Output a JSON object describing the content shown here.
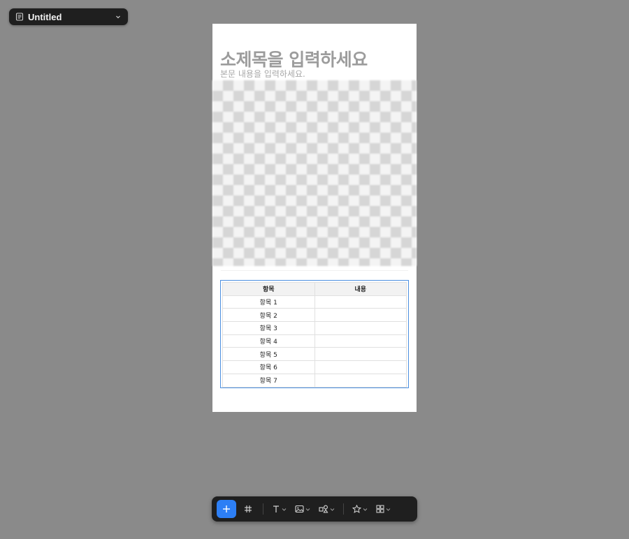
{
  "file_menu": {
    "name": "Untitled"
  },
  "page": {
    "heading": "소제목을 입력하세요",
    "body": "본문 내용을 입력하세요."
  },
  "table": {
    "headers": [
      "항목",
      "내용"
    ],
    "rows": [
      [
        "항목 1",
        ""
      ],
      [
        "항목 2",
        ""
      ],
      [
        "항목 3",
        ""
      ],
      [
        "항목 4",
        ""
      ],
      [
        "항목 5",
        ""
      ],
      [
        "항목 6",
        ""
      ],
      [
        "항목 7",
        ""
      ]
    ]
  },
  "toolbar": {
    "items": [
      "plus-icon",
      "frame-icon",
      "text-icon",
      "image-icon",
      "shapes-icon",
      "star-icon",
      "components-icon"
    ]
  },
  "colors": {
    "canvas_bg": "#8a8a8a",
    "toolbar_bg": "#1f1f1f",
    "accent": "#2d7ff5",
    "table_selection": "#4b8fe0"
  }
}
